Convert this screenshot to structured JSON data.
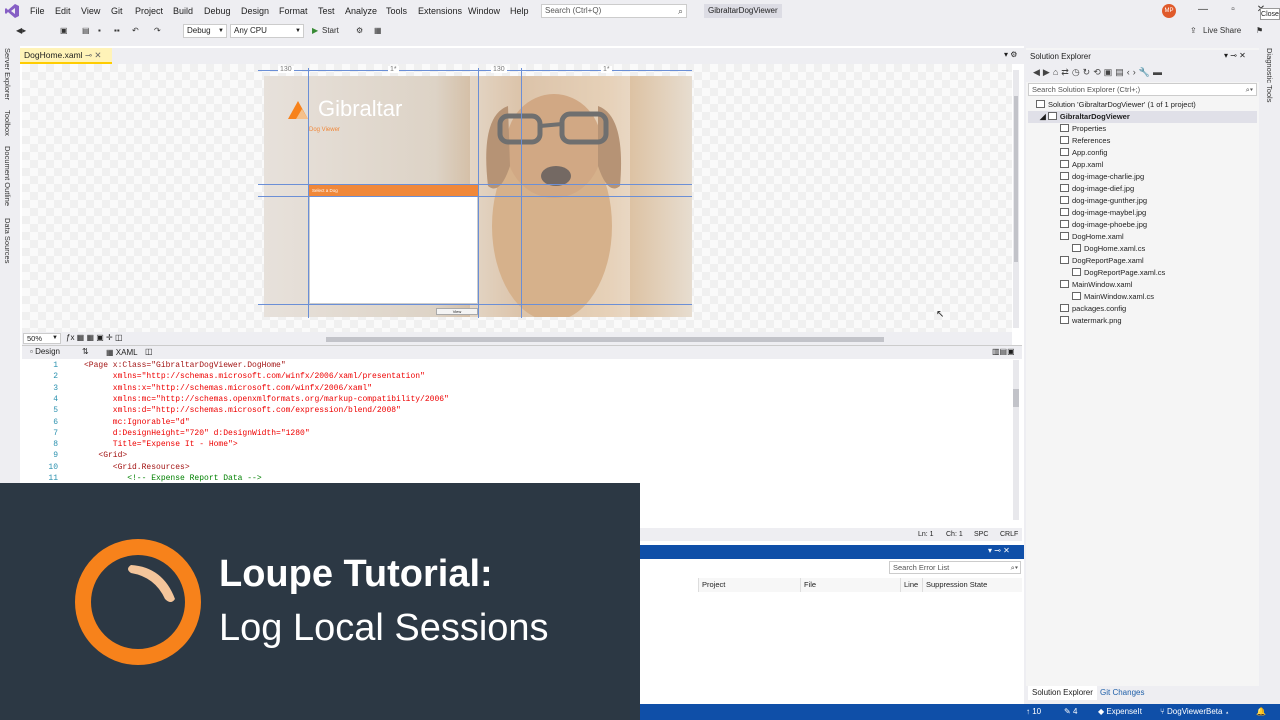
{
  "menubar": {
    "items": [
      "File",
      "Edit",
      "View",
      "Git",
      "Project",
      "Build",
      "Debug",
      "Design",
      "Format",
      "Test",
      "Analyze",
      "Tools",
      "Extensions",
      "Window",
      "Help"
    ],
    "search_placeholder": "Search (Ctrl+Q)",
    "solution_name": "GibraltarDogViewer",
    "avatar_initials": "MP",
    "close_tooltip": "Close"
  },
  "toolbar": {
    "config": "Debug",
    "platform": "Any CPU",
    "start_label": "Start",
    "live_share": "Live Share"
  },
  "left_tabs": [
    "Server Explorer",
    "Toolbox",
    "Document Outline",
    "Data Sources"
  ],
  "right_tabs": [
    "Diagnostic Tools"
  ],
  "document_tab": {
    "label": "DogHome.xaml"
  },
  "designer": {
    "ruler_marks": [
      "130",
      "1*",
      "130",
      "1*"
    ],
    "app_logo_text": "Gibraltar",
    "app_subtitle": "Dog Viewer",
    "form_header": "Select a Dog",
    "view_button": "View",
    "zoom": "50%"
  },
  "split": {
    "design_tab": "Design",
    "xaml_tab": "XAML"
  },
  "code": {
    "lines": [
      {
        "n": "1",
        "text": "<Page x:Class=\"GibraltarDogViewer.DogHome\""
      },
      {
        "n": "2",
        "text": "      xmlns=\"http://schemas.microsoft.com/winfx/2006/xaml/presentation\""
      },
      {
        "n": "3",
        "text": "      xmlns:x=\"http://schemas.microsoft.com/winfx/2006/xaml\""
      },
      {
        "n": "4",
        "text": "      xmlns:mc=\"http://schemas.openxmlformats.org/markup-compatibility/2006\""
      },
      {
        "n": "5",
        "text": "      xmlns:d=\"http://schemas.microsoft.com/expression/blend/2008\""
      },
      {
        "n": "6",
        "text": "      mc:Ignorable=\"d\""
      },
      {
        "n": "7",
        "text": "      d:DesignHeight=\"720\" d:DesignWidth=\"1280\""
      },
      {
        "n": "8",
        "text": "      Title=\"Expense It - Home\">"
      },
      {
        "n": "9",
        "text": "   <Grid>"
      },
      {
        "n": "10",
        "text": "      <Grid.Resources>"
      },
      {
        "n": "11",
        "text": "         <!-- Expense Report Data -->"
      }
    ]
  },
  "editor_status": {
    "ln": "Ln: 1",
    "ch": "Ch: 1",
    "spc": "SPC",
    "crlf": "CRLF"
  },
  "error_list": {
    "search_placeholder": "Search Error List",
    "columns": [
      "Project",
      "File",
      "Line",
      "Suppression State"
    ]
  },
  "solution_explorer": {
    "title": "Solution Explorer",
    "search_placeholder": "Search Solution Explorer (Ctrl+;)",
    "solution_line": "Solution 'GibraltarDogViewer' (1 of 1 project)",
    "project": "GibraltarDogViewer",
    "items": [
      {
        "label": "Properties",
        "indent": 2
      },
      {
        "label": "References",
        "indent": 2
      },
      {
        "label": "App.config",
        "indent": 2
      },
      {
        "label": "App.xaml",
        "indent": 2
      },
      {
        "label": "dog-image-charlie.jpg",
        "indent": 2
      },
      {
        "label": "dog-image-dief.jpg",
        "indent": 2
      },
      {
        "label": "dog-image-gunther.jpg",
        "indent": 2
      },
      {
        "label": "dog-image-maybel.jpg",
        "indent": 2
      },
      {
        "label": "dog-image-phoebe.jpg",
        "indent": 2
      },
      {
        "label": "DogHome.xaml",
        "indent": 2
      },
      {
        "label": "DogHome.xaml.cs",
        "indent": 3
      },
      {
        "label": "DogReportPage.xaml",
        "indent": 2
      },
      {
        "label": "DogReportPage.xaml.cs",
        "indent": 3
      },
      {
        "label": "MainWindow.xaml",
        "indent": 2
      },
      {
        "label": "MainWindow.xaml.cs",
        "indent": 3
      },
      {
        "label": "packages.config",
        "indent": 2
      },
      {
        "label": "watermark.png",
        "indent": 2
      }
    ],
    "tabs": [
      "Solution Explorer",
      "Git Changes"
    ]
  },
  "statusbar": {
    "up_count": "10",
    "edit_count": "4",
    "repo": "ExpenseIt",
    "branch": "DogViewerBeta"
  },
  "overlay": {
    "title": "Loupe Tutorial:",
    "subtitle": "Log Local Sessions"
  },
  "colors": {
    "accent_orange": "#f7821b",
    "vs_blue": "#0f4fa8",
    "overlay_bg": "#2c3844"
  }
}
